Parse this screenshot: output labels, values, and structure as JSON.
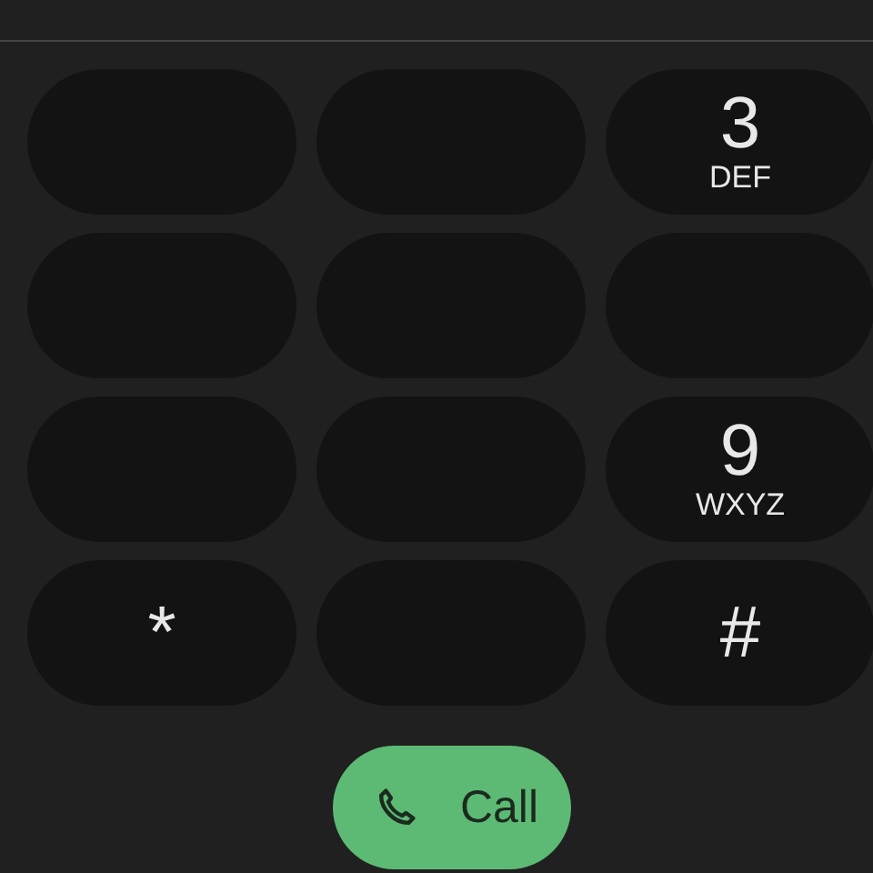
{
  "keys": [
    {
      "kind": "blank"
    },
    {
      "kind": "blank"
    },
    {
      "kind": "digit",
      "digit": "3",
      "letters": "DEF"
    },
    {
      "kind": "blank"
    },
    {
      "kind": "blank"
    },
    {
      "kind": "blank"
    },
    {
      "kind": "blank"
    },
    {
      "kind": "blank"
    },
    {
      "kind": "digit",
      "digit": "9",
      "letters": "WXYZ"
    },
    {
      "kind": "digit",
      "digit": "*"
    },
    {
      "kind": "blank"
    },
    {
      "kind": "digit",
      "digit": "#"
    }
  ],
  "call_button": {
    "label": "Call"
  }
}
